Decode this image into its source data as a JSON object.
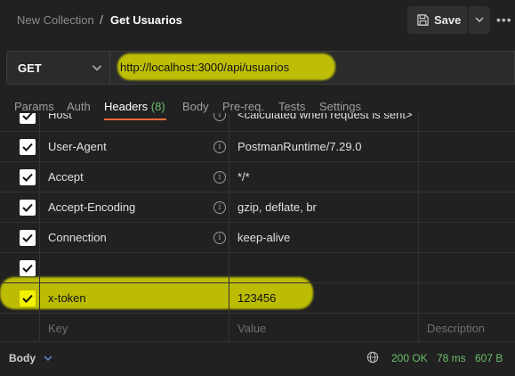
{
  "breadcrumb": {
    "collection": "New Collection",
    "separator": "/",
    "request": "Get Usuarios"
  },
  "toolbar": {
    "save_label": "Save",
    "more_label": "•••"
  },
  "request": {
    "method": "GET",
    "url": "http://localhost:3000/api/usuarios"
  },
  "tabs": [
    {
      "label": "Params"
    },
    {
      "label": "Auth"
    },
    {
      "label": "Headers",
      "count": "(8)",
      "active": true
    },
    {
      "label": "Body"
    },
    {
      "label": "Pre-req."
    },
    {
      "label": "Tests"
    },
    {
      "label": "Settings"
    }
  ],
  "headers": [
    {
      "key": "Host",
      "value": "<calculated when request is sent>",
      "checked": true
    },
    {
      "key": "User-Agent",
      "value": "PostmanRuntime/7.29.0",
      "checked": true
    },
    {
      "key": "Accept",
      "value": "*/*",
      "checked": true
    },
    {
      "key": "Accept-Encoding",
      "value": "gzip, deflate, br",
      "checked": true
    },
    {
      "key": "Connection",
      "value": "keep-alive",
      "checked": true
    },
    {
      "key": "",
      "value": "",
      "checked": true
    },
    {
      "key": "x-token",
      "value": "123456",
      "checked": true
    }
  ],
  "placeholders": {
    "key": "Key",
    "value": "Value",
    "description": "Description"
  },
  "response": {
    "body_label": "Body",
    "status": "200 OK",
    "time": "78 ms",
    "size": "607 B"
  },
  "colors": {
    "accent": "#f26b3a",
    "success": "#6cbf6c",
    "highlight": "#d8d800",
    "background": "#212121"
  },
  "icons": [
    "save-icon",
    "chevron-down-icon",
    "more-icon",
    "info-icon",
    "check-icon",
    "globe-icon"
  ]
}
